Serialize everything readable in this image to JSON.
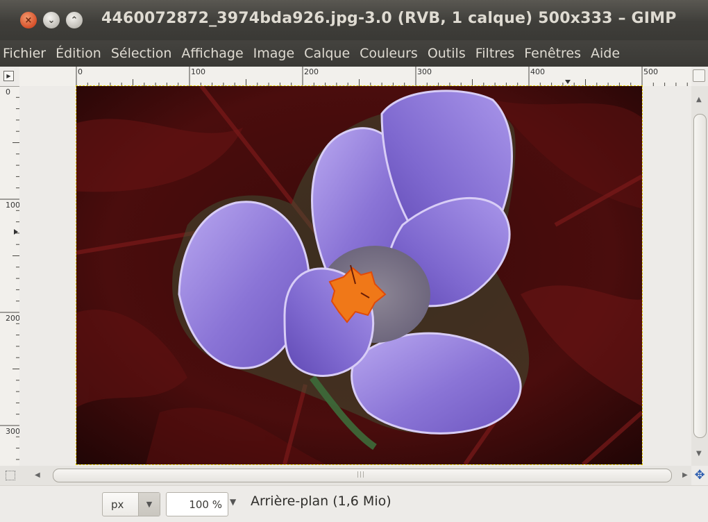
{
  "window": {
    "title": "4460072872_3974bda926.jpg-3.0 (RVB, 1 calque) 500x333 – GIMP",
    "close_glyph": "×",
    "minimize_glyph": "⌄",
    "maximize_glyph": "⌃"
  },
  "menu": {
    "items": [
      "Fichier",
      "Édition",
      "Sélection",
      "Affichage",
      "Image",
      "Calque",
      "Couleurs",
      "Outils",
      "Filtres",
      "Fenêtres",
      "Aide"
    ]
  },
  "rulers": {
    "horizontal_labels": [
      "0",
      "100",
      "200",
      "300",
      "400",
      "500"
    ],
    "vertical_labels": [
      "0",
      "100",
      "200",
      "300"
    ]
  },
  "status": {
    "unit": "px",
    "zoom": "100 %",
    "layer_info": "Arrière-plan (1,6 Mio)"
  },
  "icons": {
    "close": "close-icon",
    "minimize": "minimize-icon",
    "maximize": "maximize-icon",
    "navigation": "navigate-icon",
    "quick_mask": "quick-mask-icon"
  },
  "colors": {
    "titlebar": "#3f3e3a",
    "close_button": "#d6502a",
    "selection_border": "#e8d000",
    "background_red": "#5a0e0e",
    "petal_purple": "#8a74d6"
  }
}
